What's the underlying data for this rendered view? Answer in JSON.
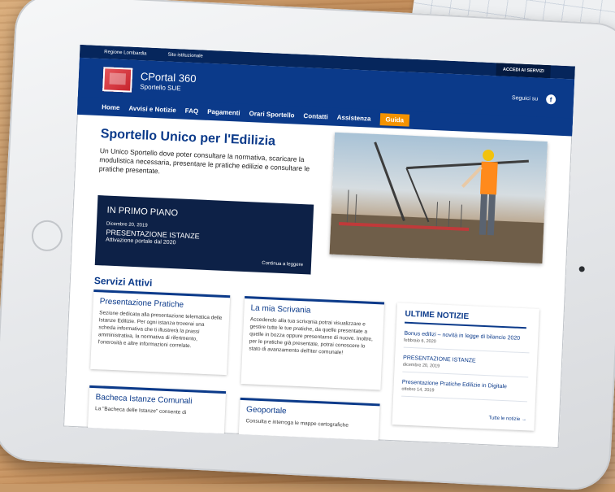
{
  "topbar": {
    "links": [
      "Regione Lombardia",
      "Sito istituzionale"
    ],
    "login": "ACCEDI AI SERVIZI"
  },
  "header": {
    "title": "CPortal 360",
    "subtitle": "Sportello SUE",
    "follow": "Seguici su",
    "social_icon": "f"
  },
  "nav": [
    "Home",
    "Avvisi e Notizie",
    "FAQ",
    "Pagamenti",
    "Orari Sportello",
    "Contatti",
    "Assistenza",
    "Guida"
  ],
  "hero": {
    "title": "Sportello Unico per l'Edilizia",
    "intro": "Un Unico Sportello dove poter consultare la normativa, scaricare la modulistica necessaria, presentare le pratiche edilizie e consultare le pratiche presentate."
  },
  "primo_piano": {
    "heading": "IN PRIMO PIANO",
    "date": "Dicembre 20, 2019",
    "title": "PRESENTAZIONE ISTANZE",
    "subtitle": "Attivazione portale dal 2020",
    "more": "Continua a leggere"
  },
  "servizi": {
    "title": "Servizi Attivi",
    "cards": [
      {
        "title": "Presentazione Pratiche",
        "desc": "Sezione dedicata alla presentazione telematica delle Istanze Edilizie. Per ogni istanza troverai una scheda informativa che ti illustrerà la prassi amministrativa, la normativa di riferimento, l'onerosità e altre informazioni correlate."
      },
      {
        "title": "La mia Scrivania",
        "desc": "Accedendo alla tua scrivania potrai visualizzare e gestire tutte le tue pratiche, da quelle presentate a quelle in bozza oppure presentarne di nuove. Inoltre, per le pratiche già presentate, potrai conoscere lo stato di avanzamento dell'iter comunale!"
      },
      {
        "title": "Bacheca Istanze Comunali",
        "desc": "La \"Bacheca delle Istanze\" consente di"
      },
      {
        "title": "Geoportale",
        "desc": "Consulta e interroga le mappe cartografiche"
      }
    ]
  },
  "news": {
    "heading": "ULTIME NOTIZIE",
    "items": [
      {
        "title": "Bonus edilizi – novità in legge di bilancio 2020",
        "date": "febbraio 6, 2020"
      },
      {
        "title": "PRESENTAZIONE ISTANZE",
        "date": "dicembre 20, 2019"
      },
      {
        "title": "Presentazione Pratiche Edilizie in Digitale",
        "date": "ottobre 14, 2019"
      }
    ],
    "all": "Tutte le notizie →"
  },
  "colors": {
    "primary": "#0b3a8a",
    "topbar": "#06265c",
    "accent": "#f39200",
    "primo_bg": "#0d2147"
  }
}
